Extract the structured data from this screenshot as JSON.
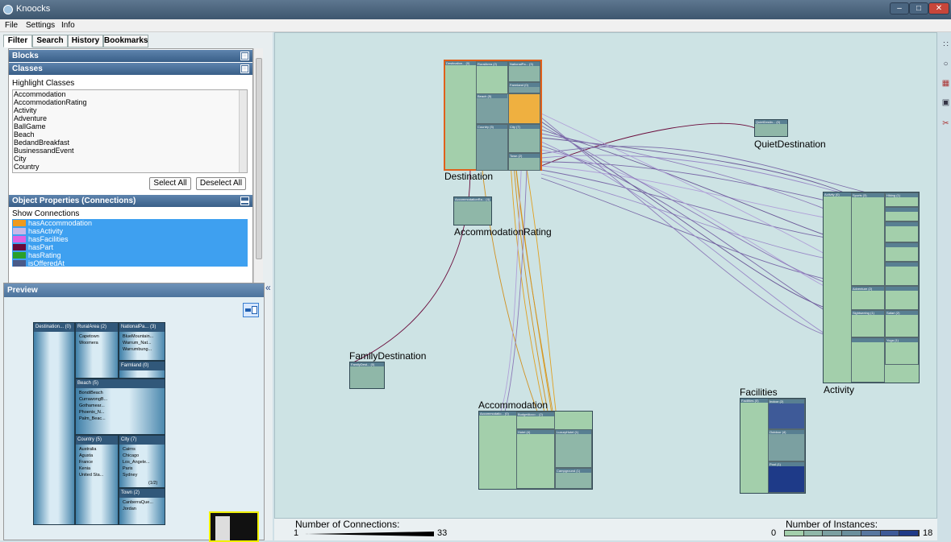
{
  "window": {
    "title": "Knoocks"
  },
  "menu": [
    "File",
    "Settings",
    "Info"
  ],
  "tabs": [
    "Filter",
    "Search",
    "History",
    "Bookmarks"
  ],
  "filter": {
    "blocks_header": "Blocks",
    "classes_header": "Classes",
    "highlight_label": "Highlight Classes",
    "classes": [
      "Accommodation",
      "AccommodationRating",
      "Activity",
      "Adventure",
      "BallGame",
      "Beach",
      "BedandBreakfast",
      "BusinessandEvent",
      "City",
      "Country"
    ],
    "select_all": "Select All",
    "deselect_all": "Deselect All",
    "object_props_header": "Object Properties (Connections)",
    "show_connections_label": "Show Connections",
    "connections": [
      {
        "name": "hasAccommodation",
        "color": "#f09a1e"
      },
      {
        "name": "hasActivity",
        "color": "#c8b8e8"
      },
      {
        "name": "hasFacilities",
        "color": "#e060e0"
      },
      {
        "name": "hasPart",
        "color": "#6a0a3a"
      },
      {
        "name": "hasRating",
        "color": "#2aa02a"
      },
      {
        "name": "isOfferedAt",
        "color": "#4a5a88"
      }
    ]
  },
  "preview": {
    "header": "Preview",
    "destination": "Destination... (0)",
    "ruralarea": "RuralArea (2)",
    "ruralarea_items": [
      "Capetown",
      "Woomera"
    ],
    "nationalpark": "NationalPa... (3)",
    "nationalpark_items": [
      "BlueMountain...",
      "Warrum_Nat...",
      "Warrumbung..."
    ],
    "farmland": "Farmland (0)",
    "beach": "Beach (5)",
    "beach_items": [
      "BondiBeach",
      "CurrawongB...",
      "Gothamear...",
      "Phoenix_N...",
      "Palm_Beac..."
    ],
    "country": "Country (5)",
    "country_items": [
      "Australia",
      "Agusta",
      "France",
      "Kenia",
      "United Sta..."
    ],
    "city": "City (7)",
    "city_items": [
      "Cairns",
      "Chicago",
      "Los_Angele...",
      "Paris",
      "Sydney"
    ],
    "city_page": "(1/2)",
    "town": "Town (2)",
    "town_items": [
      "CanberraQue...",
      "Jordan"
    ]
  },
  "canvas": {
    "nodes": {
      "destination": "Destination",
      "quiet": "QuietDestination",
      "accrating": "AccommodationRating",
      "activity": "Activity",
      "family": "FamilyDestination",
      "accommodation": "Accommodation",
      "facilities": "Facilities"
    },
    "dest_heads": [
      "Destination... (0)",
      "RuralArea (2)",
      "NationalPa... (3)",
      "Farmland (0)",
      "Beach (5)",
      "Country (5)",
      "City (7)",
      "Town (2)"
    ],
    "quiet_head": "QuietDestin... (0)",
    "accrating_head": "AccommodationRa... (4)",
    "family_head": "FamilyDest... (0)",
    "activity_heads": [
      "Activity (0)",
      "Sports (3)",
      "Hiking (1)",
      "Adventure (2)",
      "Sightseeing (1)",
      "Safari (2)",
      "Yoga (1)"
    ],
    "accommodation_heads": [
      "Accommodatio... (0)",
      "BudgetAcco... (2)",
      "Hotel (4)",
      "LuxuryHotel (1)",
      "Campground (1)"
    ],
    "facilities_heads": [
      "Facilities (0)",
      "Indoor (2)",
      "Outdoor (4)",
      "Pool (1)"
    ]
  },
  "legend": {
    "connections_label": "Number of Connections:",
    "conn_min": "1",
    "conn_max": "33",
    "instances_label": "Number of Instances:",
    "inst_min": "0",
    "inst_max": "18",
    "inst_colors": [
      "#a3cfab",
      "#8fb7a8",
      "#7ba0a1",
      "#6a8f9c",
      "#5877a0",
      "#3e5a98",
      "#1e3a88"
    ]
  }
}
